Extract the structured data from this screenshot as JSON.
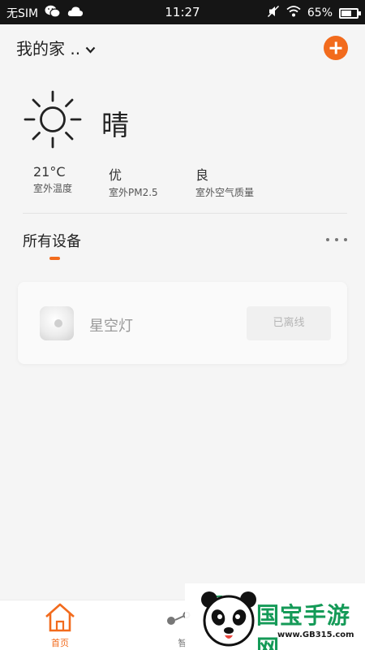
{
  "status_bar": {
    "sim": "无SIM",
    "time": "11:27",
    "battery": "65%",
    "battery_level": 0.65
  },
  "header": {
    "home_name": "我的家 ..",
    "add_icon": "plus-circle-icon"
  },
  "weather": {
    "icon": "sun-icon",
    "condition": "晴",
    "metrics": [
      {
        "value": "21°C",
        "label": "室外温度"
      },
      {
        "value": "优",
        "label": "室外PM2.5"
      },
      {
        "value": "良",
        "label": "室外空气质量"
      }
    ]
  },
  "devices_section": {
    "title": "所有设备"
  },
  "devices": [
    {
      "name": "星空灯",
      "status": "已离线"
    }
  ],
  "nav": {
    "home_label": "首页",
    "smart_label": "智"
  },
  "watermark": {
    "text": "国宝手游网",
    "url": "www.GB315.com"
  },
  "colors": {
    "accent": "#f26b1d",
    "background": "#f5f5f5",
    "status_bar": "#151515",
    "watermark_green": "#149a57"
  }
}
